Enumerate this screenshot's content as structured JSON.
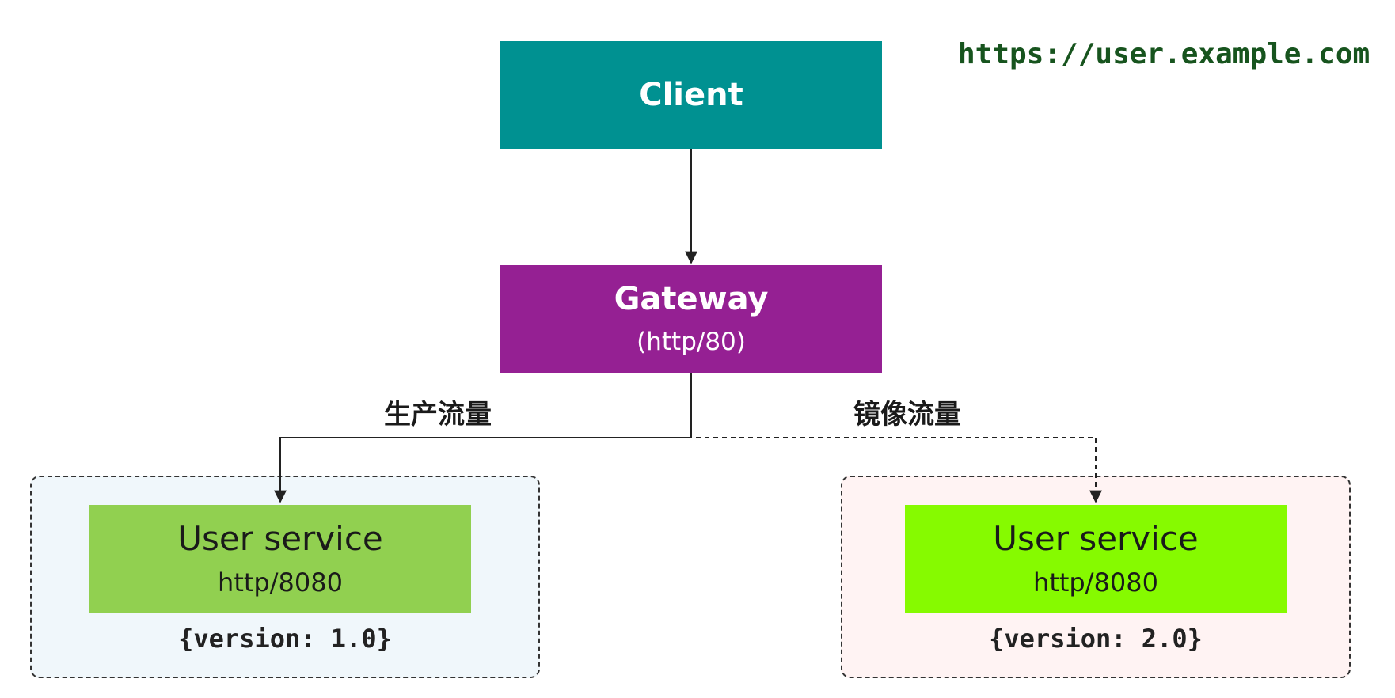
{
  "colors": {
    "client": "#009191",
    "gateway": "#952093",
    "service_v1": "#91d050",
    "service_v2": "#86fa00",
    "group_v1_bg": "#f0f7fb",
    "group_v2_bg": "#fff3f3",
    "url_text": "#17541e"
  },
  "url": "https://user.example.com",
  "client": {
    "label": "Client"
  },
  "gateway": {
    "label": "Gateway",
    "port": "(http/80)"
  },
  "edges": {
    "production_label": "生产流量",
    "mirror_label": "镜像流量"
  },
  "services": [
    {
      "label": "User service",
      "port": "http/8080",
      "version": "{version: 1.0}"
    },
    {
      "label": "User service",
      "port": "http/8080",
      "version": "{version: 2.0}"
    }
  ]
}
